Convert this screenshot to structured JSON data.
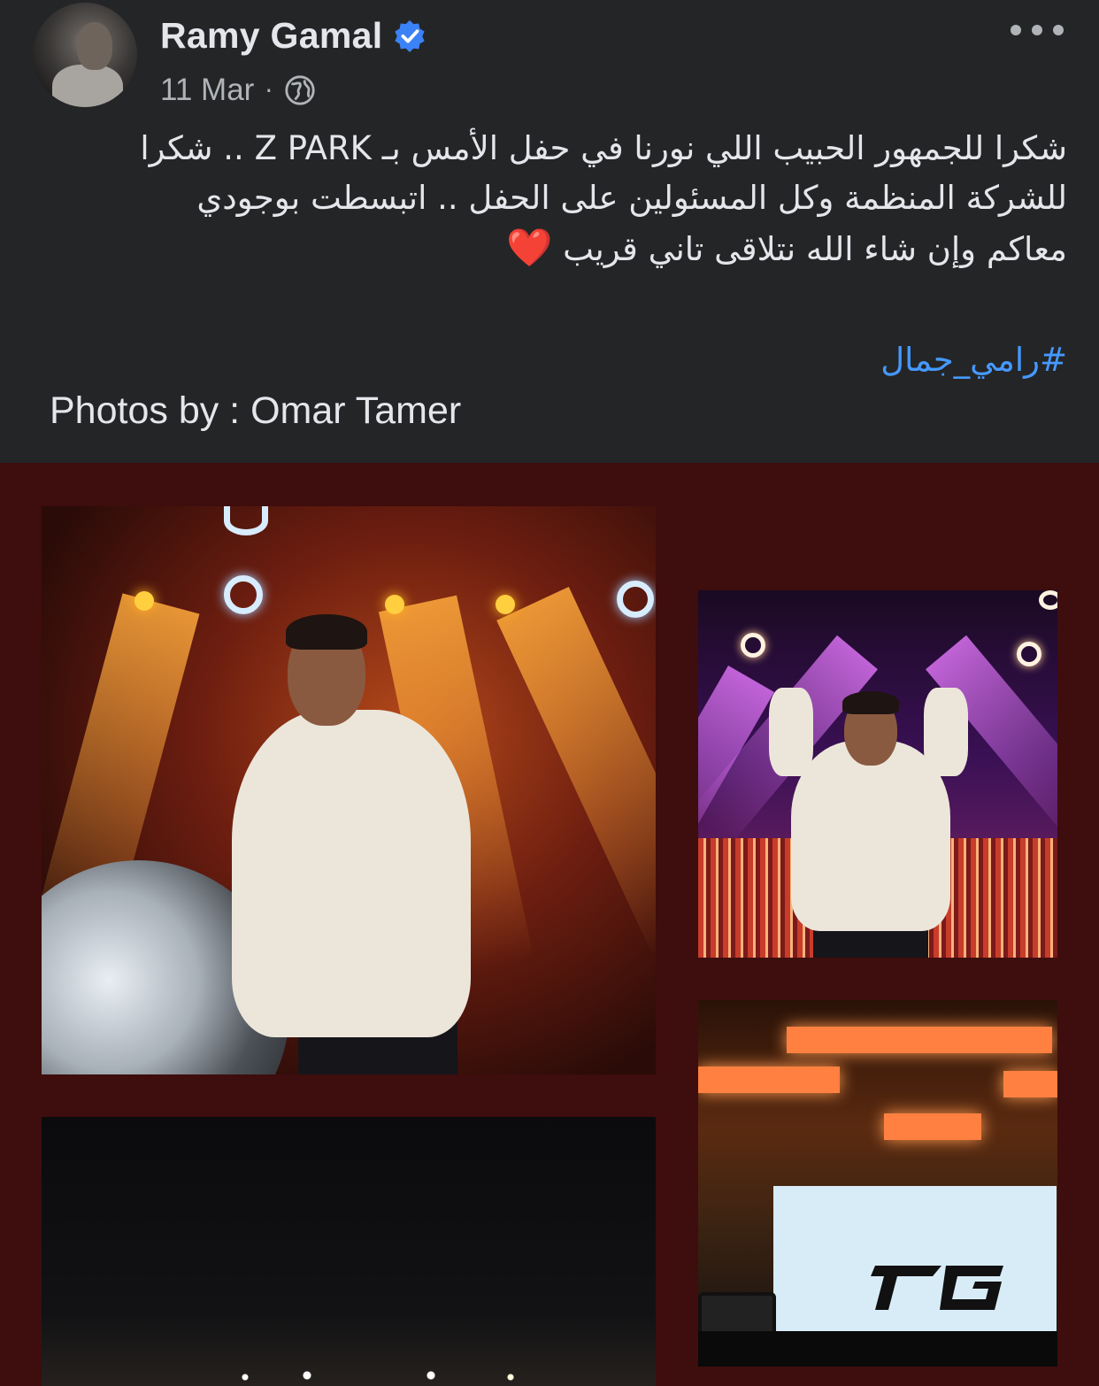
{
  "post": {
    "author": "Ramy Gamal",
    "date": "11 Mar",
    "date_separator": "·",
    "audience_icon": "globe-icon",
    "verified_icon": "verified-badge-icon",
    "menu_icon": "more-options-icon"
  },
  "body": {
    "line1": "شكرا للجمهور الحبيب اللي نورنا في حفل الأمس بـ Z PARK .. شكرا للشركة المنظمة وكل المسئولين على الحفل .. اتبسطت بوجودي",
    "line2": "معاكم وإن شاء الله نتلاقى تاني قريب",
    "heart": "❤️",
    "hashtag": "#رامي_جمال",
    "credit": "Photos by : Omar Tamer"
  },
  "colors": {
    "background": "#242526",
    "text": "#e4e6eb",
    "secondary_text": "#b0b3b8",
    "link": "#4599ff",
    "verified": "#3b82f6",
    "gallery_bg": "#3e0d0d"
  },
  "gallery": {
    "photos": [
      {
        "name": "stage-photo-singing"
      },
      {
        "name": "stage-photo-heart-hands"
      },
      {
        "name": "crowd-photo-night"
      },
      {
        "name": "stage-photo-logo-screen"
      }
    ]
  }
}
